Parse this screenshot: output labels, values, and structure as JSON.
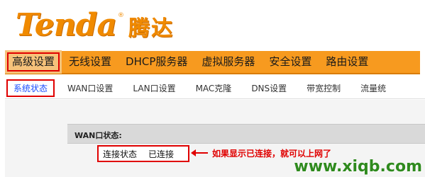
{
  "logo": {
    "latin": "Tenda",
    "registered": "®",
    "chinese": "腾达"
  },
  "nav": {
    "items": [
      {
        "label": "高级设置",
        "active": true
      },
      {
        "label": "无线设置",
        "active": false
      },
      {
        "label": "DHCP服务器",
        "active": false
      },
      {
        "label": "虚拟服务器",
        "active": false
      },
      {
        "label": "安全设置",
        "active": false
      },
      {
        "label": "路由设置",
        "active": false
      }
    ]
  },
  "subnav": {
    "items": [
      {
        "label": "系统状态",
        "active": true
      },
      {
        "label": "WAN口设置",
        "active": false
      },
      {
        "label": "LAN口设置",
        "active": false
      },
      {
        "label": "MAC克隆",
        "active": false
      },
      {
        "label": "DNS设置",
        "active": false
      },
      {
        "label": "带宽控制",
        "active": false
      },
      {
        "label": "流量统",
        "active": false
      }
    ]
  },
  "section": {
    "title": "WAN口状态:"
  },
  "status": {
    "label": "连接状态",
    "value": "已连接"
  },
  "annotation": "如果显示已连接，就可以上网了",
  "watermark": "www.xiqb.com",
  "colors": {
    "nav_orange": "#f79a1f",
    "highlight_red": "#e00000",
    "logo_orange": "#f08a00",
    "watermark_green": "#2f8a1e"
  }
}
